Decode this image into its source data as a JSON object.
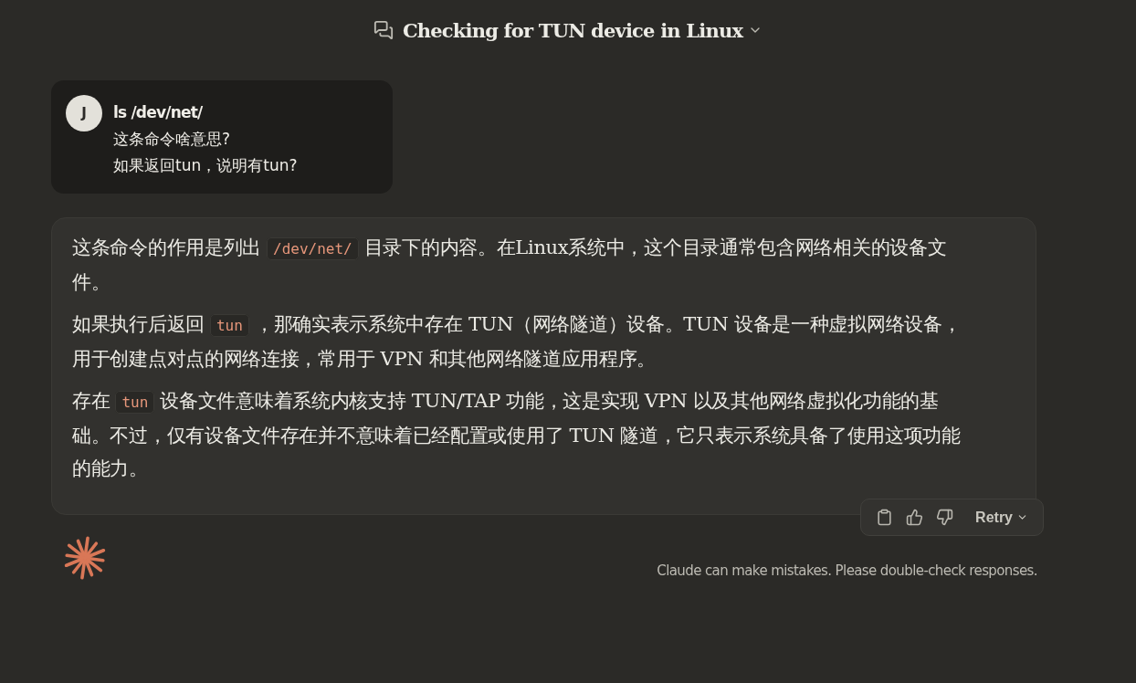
{
  "header": {
    "title": "Checking for TUN device in Linux"
  },
  "user_message": {
    "avatar": "J",
    "lines": [
      "ls /dev/net/",
      "这条命令啥意思?",
      "如果返回tun，说明有tun?"
    ]
  },
  "assistant_message": {
    "paragraphs": [
      [
        {
          "kind": "text",
          "text": "这条命令的作用是列出"
        },
        {
          "kind": "code",
          "text": "/dev/net/"
        },
        {
          "kind": "text",
          "text": "目录下的内容。在Linux系统中，这个目录通常包含网络相关的设备文件。"
        }
      ],
      [
        {
          "kind": "text",
          "text": "如果执行后返回"
        },
        {
          "kind": "code",
          "text": "tun"
        },
        {
          "kind": "text",
          "text": "，那确实表示系统中存在 TUN（网络隧道）设备。TUN 设备是一种虚拟网络设备，用于创建点对点的网络连接，常用于 VPN 和其他网络隧道应用程序。"
        }
      ],
      [
        {
          "kind": "text",
          "text": "存在"
        },
        {
          "kind": "code",
          "text": "tun"
        },
        {
          "kind": "text",
          "text": "设备文件意味着系统内核支持 TUN/TAP 功能，这是实现 VPN 以及其他网络虚拟化功能的基础。不过，仅有设备文件存在并不意味着已经配置或使用了 TUN 隧道，它只表示系统具备了使用这项功能的能力。"
        }
      ]
    ]
  },
  "actions": {
    "retry_label": "Retry"
  },
  "footer": {
    "disclaimer": "Claude can make mistakes. Please double-check responses."
  }
}
